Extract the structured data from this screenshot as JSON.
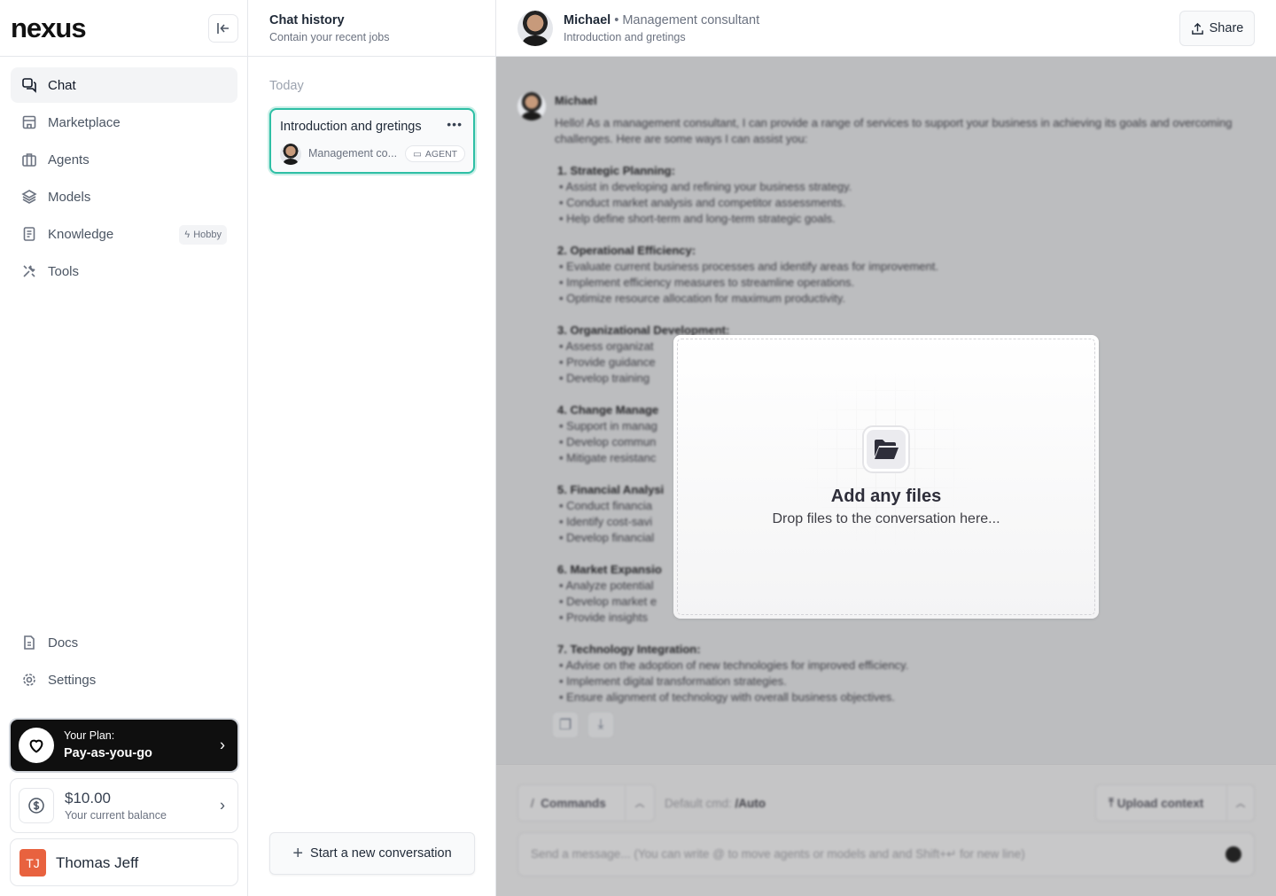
{
  "brand": {
    "logo": "nexus"
  },
  "sidebar": {
    "items": [
      {
        "label": "Chat",
        "icon": "chat-icon",
        "active": true
      },
      {
        "label": "Marketplace",
        "icon": "store-icon"
      },
      {
        "label": "Agents",
        "icon": "briefcase-icon"
      },
      {
        "label": "Models",
        "icon": "layers-icon"
      },
      {
        "label": "Knowledge",
        "icon": "document-icon",
        "badge": "Hobby"
      },
      {
        "label": "Tools",
        "icon": "tools-icon"
      }
    ],
    "bottom_items": [
      {
        "label": "Docs",
        "icon": "docs-icon"
      },
      {
        "label": "Settings",
        "icon": "gear-icon"
      }
    ],
    "plan": {
      "label": "Your Plan:",
      "value": "Pay-as-you-go"
    },
    "balance": {
      "value": "$10.00",
      "label": "Your current balance"
    },
    "user": {
      "initials": "TJ",
      "name": "Thomas Jeff",
      "color": "#e8623f"
    }
  },
  "history": {
    "title": "Chat history",
    "subtitle": "Contain your recent jobs",
    "group": "Today",
    "items": [
      {
        "title": "Introduction and gretings",
        "agent": "Management co...",
        "badge": "AGENT"
      }
    ],
    "new_button": "Start a new conversation",
    "accent": "#2ebfa5"
  },
  "header": {
    "name": "Michael",
    "separator": "•",
    "role": "Management consultant",
    "subtitle": "Introduction and gretings",
    "share": "Share"
  },
  "chat": {
    "sender": "Michael",
    "intro": "Hello! As a management consultant, I can provide a range of services to support your business in achieving its goals and overcoming challenges. Here are some ways I can assist you:",
    "sections": [
      {
        "title": "1. Strategic Planning:",
        "bullets": [
          "Assist in developing and refining your business strategy.",
          "Conduct market analysis and competitor assessments.",
          "Help define short-term and long-term strategic goals."
        ]
      },
      {
        "title": "2. Operational Efficiency:",
        "bullets": [
          "Evaluate current business processes and identify areas for improvement.",
          "Implement efficiency measures to streamline operations.",
          "Optimize resource allocation for maximum productivity."
        ]
      },
      {
        "title": "3. Organizational Development:",
        "bullets": [
          "Assess organizat",
          "Provide guidance",
          "Develop training"
        ]
      },
      {
        "title": "4. Change Manage",
        "bullets": [
          "Support in manag",
          "Develop commun",
          "Mitigate resistanc"
        ]
      },
      {
        "title": "5. Financial Analysi",
        "bullets": [
          "Conduct financia",
          "Identify cost-savi",
          "Develop financial"
        ]
      },
      {
        "title": "6. Market Expansio",
        "bullets": [
          "Analyze potential",
          "Develop market e",
          "Provide insights"
        ]
      },
      {
        "title": "7. Technology Integration:",
        "bullets": [
          "Advise on the adoption of new technologies for improved efficiency.",
          "Implement digital transformation strategies.",
          "Ensure alignment of technology with overall business objectives."
        ]
      }
    ]
  },
  "composer": {
    "commands": "Commands",
    "default_label": "Default cmd:",
    "default_value": "/Auto",
    "upload": "Upload context",
    "placeholder": "Send a message... (You can write @ to move agents or models and and Shift+↵ for new line)"
  },
  "dropzone": {
    "title": "Add any files",
    "subtitle": "Drop files to the conversation here...",
    "icon": "folder-open-icon"
  }
}
